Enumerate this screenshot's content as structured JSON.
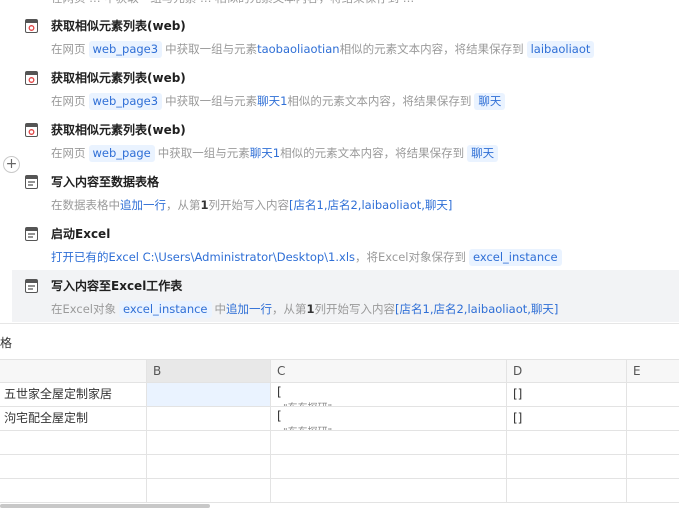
{
  "flow": {
    "steps": [
      {
        "title": "获取相似元素列表(web)",
        "desc": [
          {
            "t": "text",
            "v": "在网页"
          },
          {
            "t": "var",
            "v": "web_page3"
          },
          {
            "t": "text",
            "v": "中获取一组与元素"
          },
          {
            "t": "hl",
            "v": "taobaoliaotian"
          },
          {
            "t": "text",
            "v": "相似的元素文本内容，将结果保存到"
          },
          {
            "t": "var",
            "v": "laibaoliaot"
          }
        ]
      },
      {
        "title": "获取相似元素列表(web)",
        "desc": [
          {
            "t": "text",
            "v": "在网页"
          },
          {
            "t": "var",
            "v": "web_page3"
          },
          {
            "t": "text",
            "v": "中获取一组与元素"
          },
          {
            "t": "hl",
            "v": "聊天1"
          },
          {
            "t": "text",
            "v": "相似的元素文本内容，将结果保存到"
          },
          {
            "t": "var",
            "v": "聊天"
          }
        ]
      },
      {
        "title": "获取相似元素列表(web)",
        "desc": [
          {
            "t": "text",
            "v": "在网页"
          },
          {
            "t": "var",
            "v": "web_page"
          },
          {
            "t": "text",
            "v": "中获取一组与元素"
          },
          {
            "t": "hl",
            "v": "聊天1"
          },
          {
            "t": "text",
            "v": "相似的元素文本内容，将结果保存到"
          },
          {
            "t": "var",
            "v": "聊天"
          }
        ]
      },
      {
        "title": "写入内容至数据表格",
        "desc": [
          {
            "t": "text",
            "v": "在数据表格中"
          },
          {
            "t": "hl",
            "v": "追加一行"
          },
          {
            "t": "text",
            "v": "，从第"
          },
          {
            "t": "strong",
            "v": "1"
          },
          {
            "t": "text",
            "v": "列开始写入内容"
          },
          {
            "t": "hl",
            "v": "[店名1,店名2,laibaoliaot,聊天]"
          }
        ]
      },
      {
        "title": "启动Excel",
        "desc": [
          {
            "t": "hl",
            "v": "打开已有的Excel C:\\Users\\Administrator\\Desktop\\1.xls"
          },
          {
            "t": "text",
            "v": "，将Excel对象保存到"
          },
          {
            "t": "var",
            "v": "excel_instance"
          }
        ]
      },
      {
        "title": "写入内容至Excel工作表",
        "desc": [
          {
            "t": "text",
            "v": "在Excel对象"
          },
          {
            "t": "var",
            "v": "excel_instance"
          },
          {
            "t": "text",
            "v": "中"
          },
          {
            "t": "hl",
            "v": "追加一行"
          },
          {
            "t": "text",
            "v": "，从第"
          },
          {
            "t": "strong",
            "v": "1"
          },
          {
            "t": "text",
            "v": "列开始写入内容"
          },
          {
            "t": "hl",
            "v": "[店名1,店名2,laibaoliaot,聊天]"
          }
        ]
      }
    ],
    "add_symbol": "+"
  },
  "sheet": {
    "title": "格",
    "columns": [
      "",
      "B",
      "C",
      "D",
      "E"
    ],
    "rows": [
      [
        "五世家全屋定制家居",
        "",
        "[",
        "[]",
        ""
      ],
      [
        "泃宅配全屋定制",
        "",
        "[",
        "[]",
        ""
      ]
    ],
    "cell_sub": "\"东东探研\"",
    "empty_rows": 3
  },
  "colors": {
    "accent": "#2f6fd6",
    "var_bg": "#eaf3ff",
    "selected_bg": "#f2f3f5"
  }
}
